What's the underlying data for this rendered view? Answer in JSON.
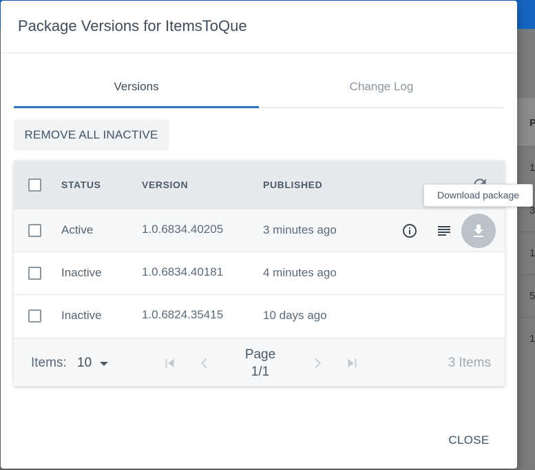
{
  "dialog": {
    "title": "Package Versions for ItemsToQue",
    "close_label": "CLOSE"
  },
  "tabs": [
    {
      "label": "Versions",
      "active": true
    },
    {
      "label": "Change Log",
      "active": false
    }
  ],
  "remove_inactive_label": "REMOVE ALL INACTIVE",
  "grid": {
    "columns": {
      "status": "STATUS",
      "version": "VERSION",
      "published": "PUBLISHED"
    },
    "rows": [
      {
        "status": "Active",
        "version": "1.0.6834.40205",
        "published": "3 minutes ago"
      },
      {
        "status": "Inactive",
        "version": "1.0.6834.40181",
        "published": "4 minutes ago"
      },
      {
        "status": "Inactive",
        "version": "1.0.6824.35415",
        "published": "10 days ago"
      }
    ],
    "row_actions": {
      "icons": [
        "info-icon",
        "changelog-icon",
        "download-icon"
      ]
    },
    "tooltip": "Download package"
  },
  "pager": {
    "items_label": "Items:",
    "page_size": "10",
    "page_label": "Page",
    "page_value": "1/1",
    "total": "3 Items"
  },
  "background_table": {
    "header": "P",
    "rows": [
      "1",
      "3",
      "1",
      "5",
      "1"
    ]
  },
  "colors": {
    "accent": "#2f74c0",
    "topbar": "#1565c0"
  }
}
